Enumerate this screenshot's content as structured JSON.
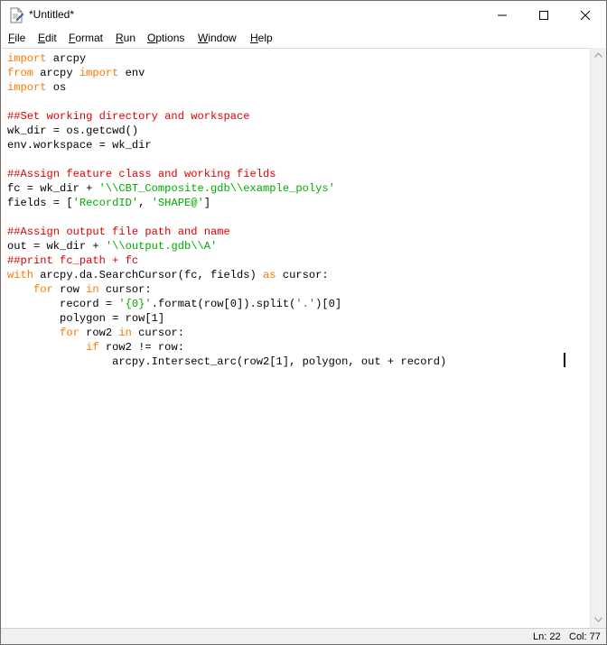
{
  "window": {
    "title": "*Untitled*"
  },
  "menu": [
    {
      "label": "File",
      "underline": "F",
      "rest": "ile"
    },
    {
      "label": "Edit",
      "underline": "E",
      "rest": "dit"
    },
    {
      "label": "Format",
      "underline": "F",
      "rest": "ormat"
    },
    {
      "label": "Run",
      "underline": "R",
      "rest": "un"
    },
    {
      "label": "Options",
      "underline": "O",
      "rest": "ptions"
    },
    {
      "label": "Window",
      "underline": "W",
      "rest": "indow"
    },
    {
      "label": "Help",
      "underline": "H",
      "rest": "elp"
    }
  ],
  "code": [
    [
      [
        "kw",
        "import"
      ],
      [
        "n",
        " arcpy"
      ]
    ],
    [
      [
        "kw",
        "from"
      ],
      [
        "n",
        " arcpy "
      ],
      [
        "kw",
        "import"
      ],
      [
        "n",
        " env"
      ]
    ],
    [
      [
        "kw",
        "import"
      ],
      [
        "n",
        " os"
      ]
    ],
    [],
    [
      [
        "cmt",
        "##Set working directory and workspace"
      ]
    ],
    [
      [
        "n",
        "wk_dir = os.getcwd()"
      ]
    ],
    [
      [
        "n",
        "env.workspace = wk_dir"
      ]
    ],
    [],
    [
      [
        "cmt",
        "##Assign feature class and working fields"
      ]
    ],
    [
      [
        "n",
        "fc = wk_dir + "
      ],
      [
        "str",
        "'\\\\CBT_Composite.gdb\\\\example_polys'"
      ]
    ],
    [
      [
        "n",
        "fields = ["
      ],
      [
        "str",
        "'RecordID'"
      ],
      [
        "n",
        ", "
      ],
      [
        "str",
        "'SHAPE@'"
      ],
      [
        "n",
        "]"
      ]
    ],
    [],
    [
      [
        "cmt",
        "##Assign output file path and name"
      ]
    ],
    [
      [
        "n",
        "out = wk_dir + "
      ],
      [
        "str",
        "'\\\\output.gdb\\\\A'"
      ]
    ],
    [
      [
        "cmt",
        "##print fc_path + fc"
      ]
    ],
    [
      [
        "kw",
        "with"
      ],
      [
        "n",
        " arcpy.da.SearchCursor(fc, fields) "
      ],
      [
        "kw",
        "as"
      ],
      [
        "n",
        " cursor:"
      ]
    ],
    [
      [
        "n",
        "    "
      ],
      [
        "kw",
        "for"
      ],
      [
        "n",
        " row "
      ],
      [
        "kw",
        "in"
      ],
      [
        "n",
        " cursor:"
      ]
    ],
    [
      [
        "n",
        "        record = "
      ],
      [
        "str",
        "'{0}'"
      ],
      [
        "n",
        ".format(row[0]).split("
      ],
      [
        "str",
        "'.'"
      ],
      [
        "n",
        ")[0]"
      ]
    ],
    [
      [
        "n",
        "        polygon = row[1]"
      ]
    ],
    [
      [
        "n",
        "        "
      ],
      [
        "kw",
        "for"
      ],
      [
        "n",
        " row2 "
      ],
      [
        "kw",
        "in"
      ],
      [
        "n",
        " cursor:"
      ]
    ],
    [
      [
        "n",
        "            "
      ],
      [
        "kw",
        "if"
      ],
      [
        "n",
        " row2 != row:"
      ]
    ],
    [
      [
        "n",
        "                arcpy.Intersect_arc(row2[1], polygon, out + record)"
      ]
    ]
  ],
  "status": {
    "line": "Ln: 22",
    "col": "Col: 77"
  }
}
